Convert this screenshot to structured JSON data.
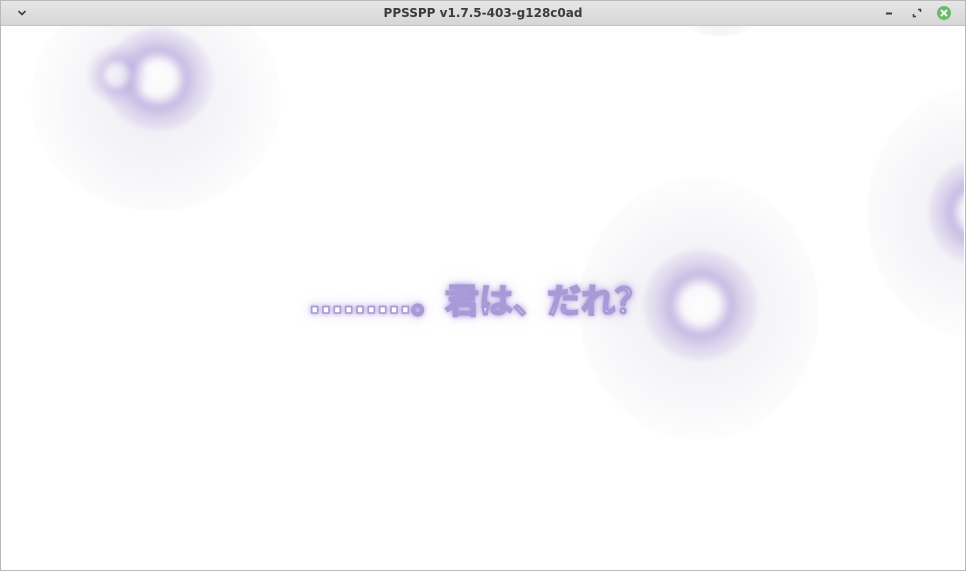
{
  "window": {
    "title": "PPSSPP v1.7.5-403-g128c0ad",
    "buttons": {
      "menu_icon": "chevron-down-icon",
      "minimize_icon": "minimize-icon",
      "maximize_icon": "maximize-icon",
      "close_icon": "close-icon",
      "close_color": "#6db96a"
    }
  },
  "game": {
    "dialogue": "………。君は、だれ？",
    "text_color": "#ffffff",
    "glow_color": "#a89ad6",
    "background_color": "#ffffff"
  }
}
